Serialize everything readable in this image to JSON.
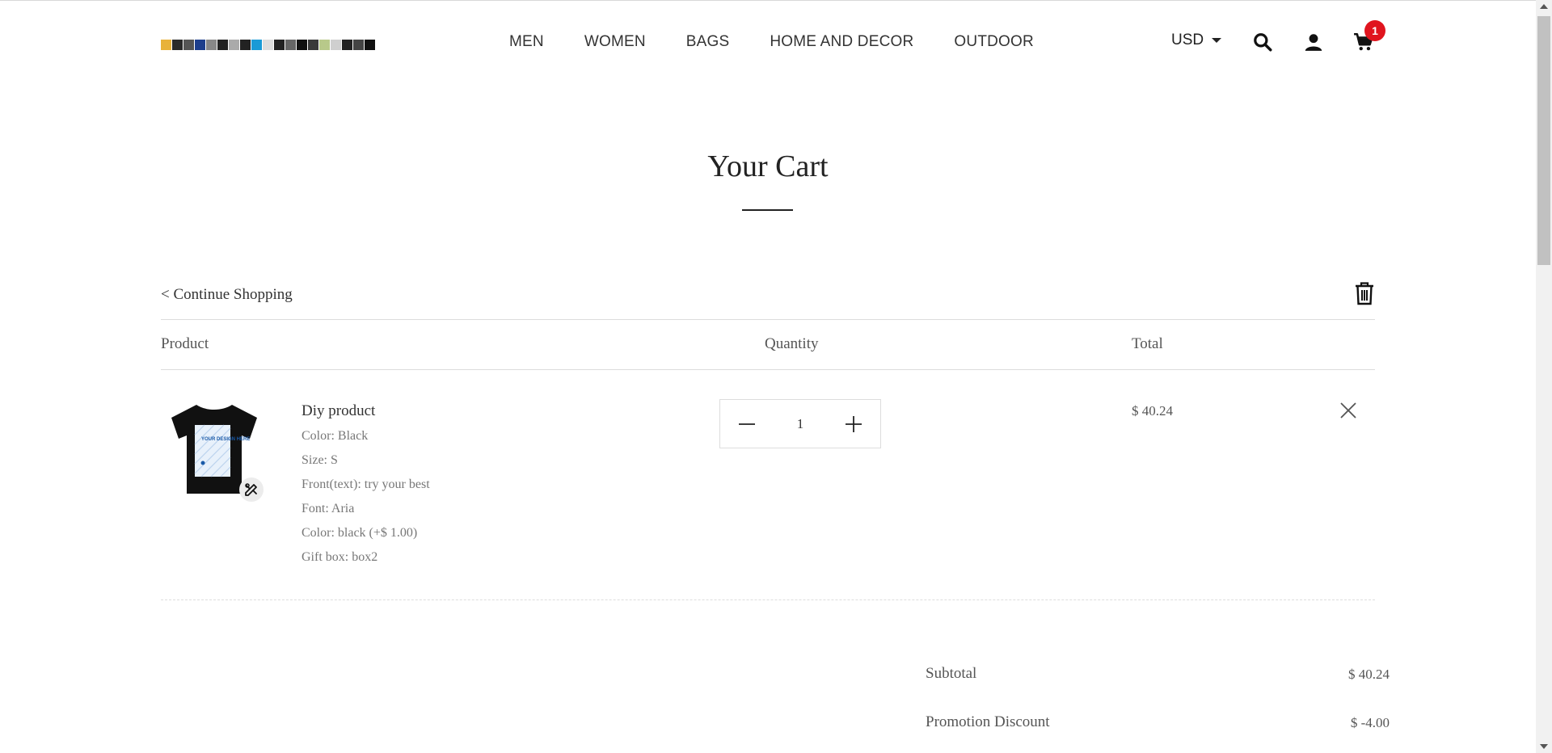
{
  "header": {
    "nav": [
      "MEN",
      "WOMEN",
      "BAGS",
      "HOME AND DECOR",
      "OUTDOOR"
    ],
    "currency": "USD",
    "cart_count": "1",
    "icons": [
      "search-icon",
      "user-icon",
      "cart-icon"
    ]
  },
  "page": {
    "title": "Your Cart",
    "continue_label": "< Continue Shopping"
  },
  "table": {
    "headers": {
      "product": "Product",
      "quantity": "Quantity",
      "total": "Total"
    }
  },
  "items": [
    {
      "name": "Diy product",
      "options": [
        "Color: Black",
        "Size: S",
        "Front(text): try your best",
        "Font: Aria",
        "Color: black (+$ 1.00)",
        "Gift box: box2"
      ],
      "quantity": "1",
      "total": "$ 40.24",
      "thumb_text": "YOUR DESIGN HERE"
    }
  ],
  "summary": {
    "subtotal_label": "Subtotal",
    "subtotal_value": "$ 40.24",
    "discount_label": "Promotion Discount",
    "discount_value": "$ -4.00"
  },
  "colors": {
    "badge": "#e0141e",
    "text": "#222222",
    "muted": "#777777",
    "rule": "#dddddd"
  }
}
